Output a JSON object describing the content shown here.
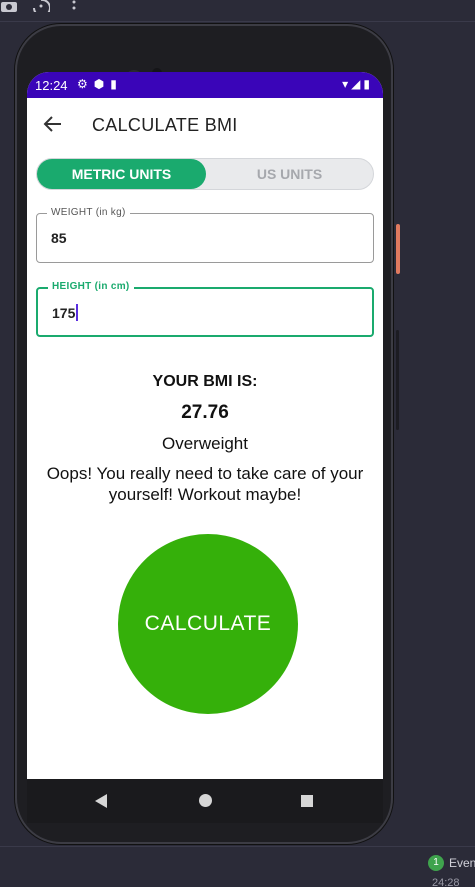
{
  "ide": {
    "toolbar_icons": [
      "camera-icon",
      "history-icon",
      "more-vert-icon"
    ],
    "events_badge": "1",
    "events_label": "Even",
    "events_time": "24:28"
  },
  "status_bar": {
    "time": "12:24",
    "left_icons": [
      "settings-icon",
      "shield-icon",
      "sd-card-icon"
    ],
    "right_icons": [
      "wifi-icon",
      "signal-icon",
      "battery-icon"
    ]
  },
  "app_bar": {
    "title": "CALCULATE BMI",
    "back_icon": "arrow-back-icon"
  },
  "units_toggle": {
    "options": [
      {
        "label": "METRIC UNITS",
        "selected": true
      },
      {
        "label": "US UNITS",
        "selected": false
      }
    ]
  },
  "weight_field": {
    "label": "WEIGHT (in kg)",
    "value": "85"
  },
  "height_field": {
    "label": "HEIGHT (in cm)",
    "value": "175"
  },
  "result": {
    "heading": "YOUR BMI IS:",
    "value": "27.76",
    "category": "Overweight",
    "description": "Oops! You really need to take care of your yourself! Workout maybe!"
  },
  "calculate_button": {
    "label": "CALCULATE"
  },
  "colors": {
    "status_bar": "#3a05b8",
    "accent": "#1aaa6e",
    "button": "#35b00a"
  },
  "nav_bar": {
    "icons": [
      "nav-back-icon",
      "nav-home-icon",
      "nav-recents-icon"
    ]
  }
}
